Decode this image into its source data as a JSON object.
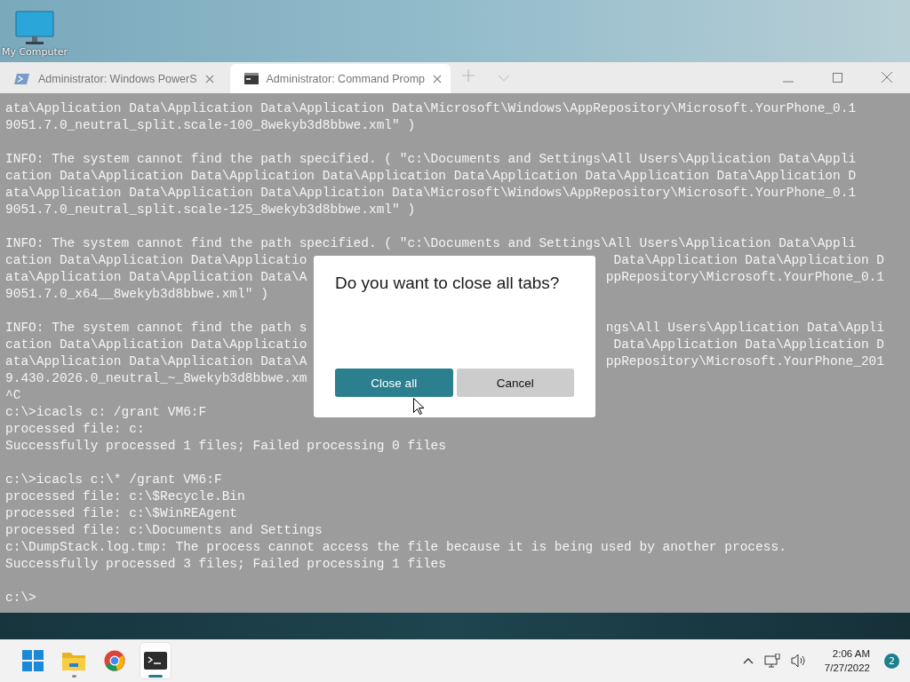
{
  "desktop": {
    "icons": [
      {
        "label": "My Computer"
      }
    ]
  },
  "window": {
    "tabs": [
      {
        "title": "Administrator: Windows PowerS",
        "kind": "powershell",
        "selected": false
      },
      {
        "title": "Administrator: Command Promp",
        "kind": "cmd",
        "selected": true
      }
    ]
  },
  "console": {
    "lines": [
      {
        "kind": "text",
        "text": "ata\\Application Data\\Application Data\\Application Data\\Microsoft\\Windows\\AppRepository\\Microsoft.YourPhone_0.1"
      },
      {
        "kind": "text",
        "text": "9051.7.0_neutral_split.scale-100_8wekyb3d8bbwe.xml\" )"
      },
      {
        "kind": "blank"
      },
      {
        "kind": "text",
        "text": "INFO: The system cannot find the path specified. ( \"c:\\Documents and Settings\\All Users\\Application Data\\Appli"
      },
      {
        "kind": "text",
        "text": "cation Data\\Application Data\\Application Data\\Application Data\\Application Data\\Application Data\\Application D"
      },
      {
        "kind": "text",
        "text": "ata\\Application Data\\Application Data\\Application Data\\Microsoft\\Windows\\AppRepository\\Microsoft.YourPhone_0.1"
      },
      {
        "kind": "text",
        "text": "9051.7.0_neutral_split.scale-125_8wekyb3d8bbwe.xml\" )"
      },
      {
        "kind": "blank"
      },
      {
        "kind": "text",
        "text": "INFO: The system cannot find the path specified. ( \"c:\\Documents and Settings\\All Users\\Application Data\\Appli"
      },
      {
        "kind": "split",
        "text": "cation Data\\Application Data\\Applicatio",
        "right": "Data\\Application Data\\Application D"
      },
      {
        "kind": "split",
        "text": "ata\\Application Data\\Application Data\\A",
        "right": "ppRepository\\Microsoft.YourPhone_0.1"
      },
      {
        "kind": "text",
        "text": "9051.7.0_x64__8wekyb3d8bbwe.xml\" )"
      },
      {
        "kind": "blank"
      },
      {
        "kind": "split",
        "text": "INFO: The system cannot find the path s",
        "right": "ngs\\All Users\\Application Data\\Appli"
      },
      {
        "kind": "split",
        "text": "cation Data\\Application Data\\Applicatio",
        "right": "Data\\Application Data\\Application D"
      },
      {
        "kind": "split",
        "text": "ata\\Application Data\\Application Data\\A",
        "right": "ppRepository\\Microsoft.YourPhone_201"
      },
      {
        "kind": "text",
        "text": "9.430.2026.0_neutral_~_8wekyb3d8bbwe.xm"
      },
      {
        "kind": "text",
        "text": "^C"
      },
      {
        "kind": "text",
        "text": "c:\\>icacls c: /grant VM6:F"
      },
      {
        "kind": "text",
        "text": "processed file: c:"
      },
      {
        "kind": "text",
        "text": "Successfully processed 1 files; Failed processing 0 files"
      },
      {
        "kind": "blank"
      },
      {
        "kind": "text",
        "text": "c:\\>icacls c:\\* /grant VM6:F"
      },
      {
        "kind": "text",
        "text": "processed file: c:\\$Recycle.Bin"
      },
      {
        "kind": "text",
        "text": "processed file: c:\\$WinREAgent"
      },
      {
        "kind": "text",
        "text": "processed file: c:\\Documents and Settings"
      },
      {
        "kind": "text",
        "text": "c:\\DumpStack.log.tmp: The process cannot access the file because it is being used by another process."
      },
      {
        "kind": "text",
        "text": "Successfully processed 3 files; Failed processing 1 files"
      },
      {
        "kind": "blank"
      },
      {
        "kind": "text",
        "text": "c:\\>"
      }
    ]
  },
  "dialog": {
    "title": "Do you want to close all tabs?",
    "buttons": [
      {
        "label": "Close all",
        "kind": "primary"
      },
      {
        "label": "Cancel",
        "kind": "secondary"
      }
    ]
  },
  "taskbar": {
    "apps": [
      {
        "kind": "start",
        "running": false,
        "selected": false
      },
      {
        "kind": "explorer",
        "running": true,
        "selected": false
      },
      {
        "kind": "browser",
        "running": false,
        "selected": false
      },
      {
        "kind": "terminal",
        "running": true,
        "selected": true
      }
    ],
    "time": "2:06 AM",
    "date": "7/27/2022",
    "notification_count": "2"
  }
}
